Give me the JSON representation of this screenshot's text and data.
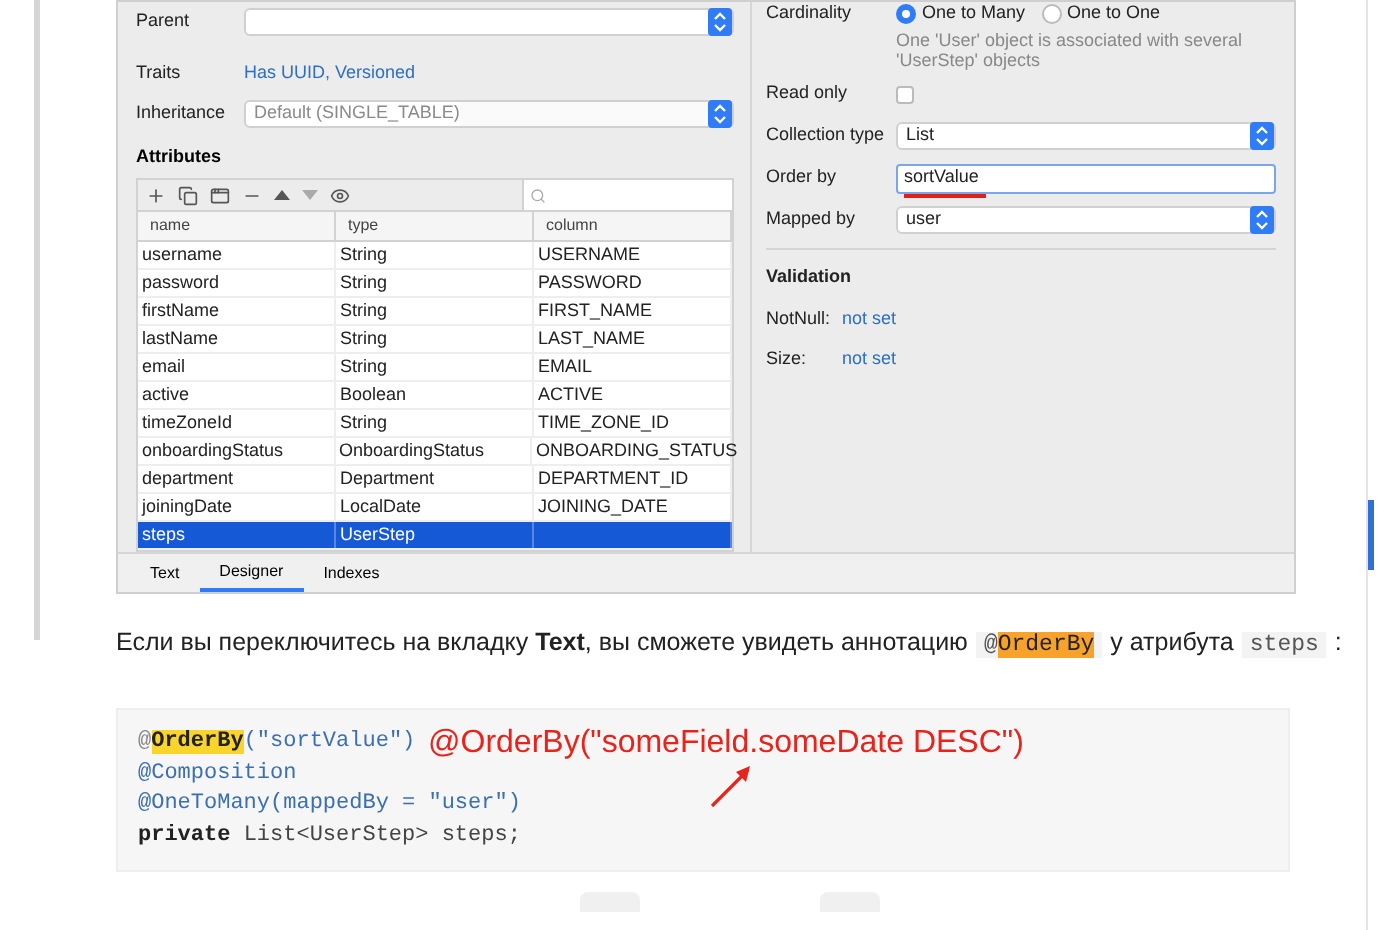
{
  "designer": {
    "left": {
      "fields": [
        {
          "kind": "select",
          "label": "Parent"
        },
        {
          "kind": "link",
          "label": "Traits",
          "value": "Has UUID, Versioned"
        },
        {
          "kind": "select",
          "label": "Inheritance",
          "value": "Default (SINGLE_TABLE)",
          "disabled": true
        }
      ],
      "attributes_title": "Attributes",
      "columns": [
        "name",
        "type",
        "column"
      ],
      "rows": [
        {
          "name": "username",
          "type": "String",
          "column": "USERNAME",
          "selected": false
        },
        {
          "name": "password",
          "type": "String",
          "column": "PASSWORD",
          "selected": false
        },
        {
          "name": "firstName",
          "type": "String",
          "column": "FIRST_NAME",
          "selected": false
        },
        {
          "name": "lastName",
          "type": "String",
          "column": "LAST_NAME",
          "selected": false
        },
        {
          "name": "email",
          "type": "String",
          "column": "EMAIL",
          "selected": false
        },
        {
          "name": "active",
          "type": "Boolean",
          "column": "ACTIVE",
          "selected": false
        },
        {
          "name": "timeZoneId",
          "type": "String",
          "column": "TIME_ZONE_ID",
          "selected": false
        },
        {
          "name": "onboardingStatus",
          "type": "OnboardingStatus",
          "column": "ONBOARDING_STATUS",
          "selected": false
        },
        {
          "name": "department",
          "type": "Department",
          "column": "DEPARTMENT_ID",
          "selected": false
        },
        {
          "name": "joiningDate",
          "type": "LocalDate",
          "column": "JOINING_DATE",
          "selected": false
        },
        {
          "name": "steps",
          "type": "UserStep",
          "column": "",
          "selected": true
        }
      ]
    },
    "right": {
      "cardinality": {
        "label": "Cardinality",
        "options": [
          {
            "label": "One to Many",
            "selected": true
          },
          {
            "label": "One to One",
            "selected": false
          }
        ],
        "hint": "One 'User' object is associated with several 'UserStep' objects"
      },
      "read_only": {
        "label": "Read only",
        "checked": false
      },
      "fields": [
        {
          "kind": "select",
          "label": "Collection type",
          "value": "List"
        },
        {
          "kind": "input",
          "label": "Order by",
          "value": "sortValue",
          "underlined": true
        },
        {
          "kind": "select",
          "label": "Mapped by",
          "value": "user"
        }
      ],
      "validation": {
        "title": "Validation",
        "items": [
          {
            "label": "NotNull:",
            "value": "not set"
          },
          {
            "label": "Size:",
            "value": "not set"
          }
        ]
      }
    },
    "tabs": [
      {
        "label": "Text",
        "selected": false
      },
      {
        "label": "Designer",
        "selected": true
      },
      {
        "label": "Indexes",
        "selected": false
      }
    ]
  },
  "paragraph": [
    {
      "kind": "text",
      "text": "Если вы переключитесь на вкладку **Text**, вы сможете увидеть аннотацию"
    },
    {
      "kind": "code",
      "prefix": "@",
      "highlight": "OrderBy"
    },
    {
      "kind": "text",
      "text": "у атрибута"
    },
    {
      "kind": "code",
      "prefix": "steps"
    },
    {
      "kind": "text",
      "text": ":"
    }
  ],
  "code_lines": [
    [
      {
        "kind": "at",
        "text": "@"
      },
      {
        "kind": "highlight",
        "text": "OrderBy"
      },
      {
        "kind": "string",
        "text": "(\"sortValue\")"
      }
    ],
    [
      {
        "kind": "annotation",
        "text": "@Composition"
      }
    ],
    [
      {
        "kind": "annotation",
        "text": "@OneToMany(mappedBy = \"user\")"
      }
    ],
    [
      {
        "kind": "keyword",
        "text": "private"
      },
      {
        "kind": "plain",
        "text": " List<UserStep> steps;"
      }
    ]
  ],
  "callout": "@OrderBy(\"someField.someDate DESC\")"
}
